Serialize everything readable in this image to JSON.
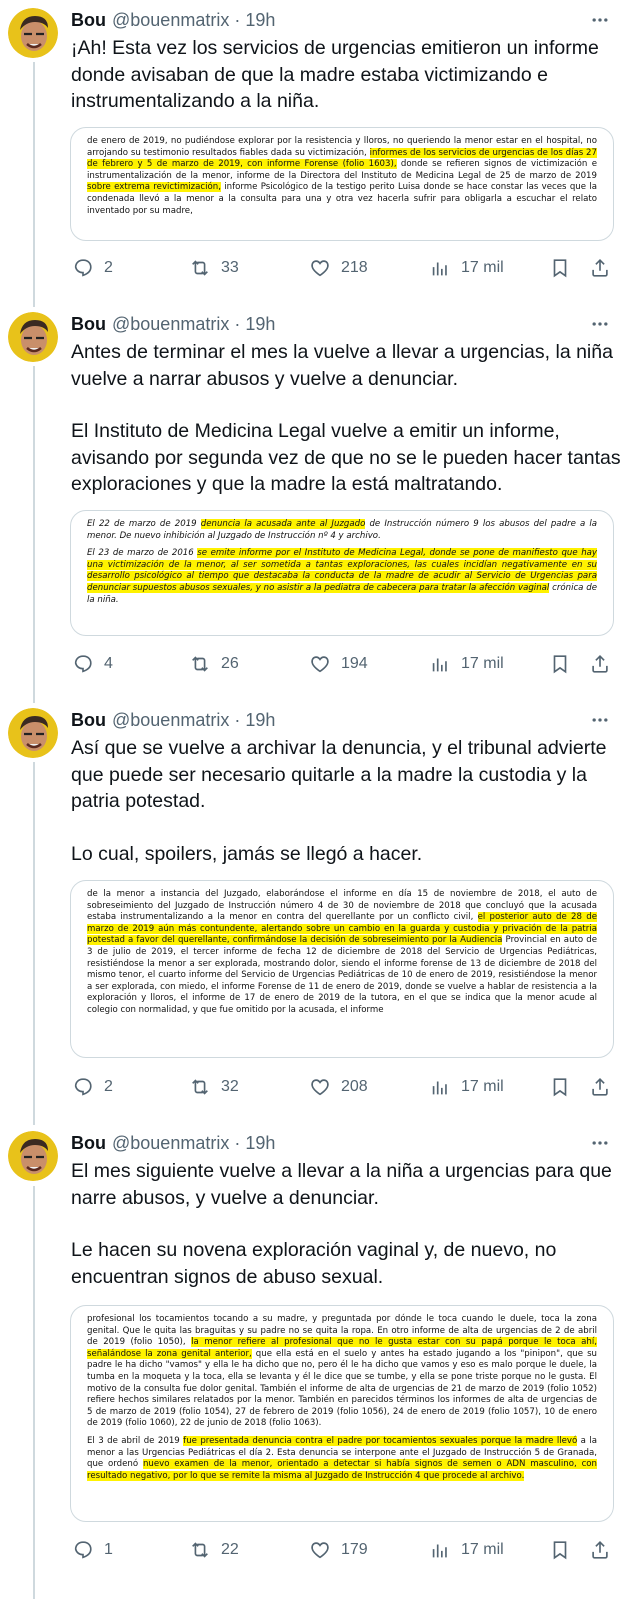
{
  "tweets": [
    {
      "name": "Bou",
      "handle": "@bouenmatrix",
      "dot": "·",
      "time": "19h",
      "paragraphs": [
        "¡Ah! Esta vez los servicios de urgencias emitieron un informe donde avisaban de que la madre estaba victimizando e instrumentalizando a la niña."
      ],
      "doc": {
        "italic": false,
        "paragraphs": [
          [
            {
              "t": "de enero de 2019, no pudiéndose explorar por la resistencia y lloros, no queriendo la menor estar en el hospital, no arrojando su testimonio resultados fiables dada su victimización, ",
              "h": false
            },
            {
              "t": "informes de los servicios de urgencias de los días 27 de febrero y 5 de marzo de 2019, con informe Forense (folio 1603),",
              "h": true
            },
            {
              "t": " donde se refieren signos de victimización e instrumentalización de la menor, informe de la Directora del Instituto de Medicina Legal de 25 de marzo de 2019 ",
              "h": false
            },
            {
              "t": "sobre extrema revictimización,",
              "h": true
            },
            {
              "t": " informe Psicológico de la testigo perito  Luisa  donde se hace constar las veces que la condenada llevó a la menor a la consulta para una y otra vez hacerla sufrir para obligarla a escuchar el relato inventado por su madre,",
              "h": false
            }
          ]
        ]
      },
      "stats": {
        "replies": "2",
        "retweets": "33",
        "likes": "218",
        "views": "17 mil"
      }
    },
    {
      "name": "Bou",
      "handle": "@bouenmatrix",
      "dot": "·",
      "time": "19h",
      "paragraphs": [
        "Antes de terminar el mes la vuelve a llevar a urgencias, la niña vuelve a narrar abusos y vuelve a denunciar.",
        "El Instituto de Medicina Legal vuelve a emitir un informe, avisando por segunda vez de que no se le pueden hacer tantas exploraciones y que la madre la está maltratando."
      ],
      "doc": {
        "italic": true,
        "paragraphs": [
          [
            {
              "t": "El 22 de marzo de 2019 ",
              "h": false
            },
            {
              "t": "denuncia la acusada ante al Juzgado",
              "h": true
            },
            {
              "t": " de Instrucción número 9 los abusos del padre a la menor. De nuevo inhibición al Juzgado de Instrucción nº 4 y archivo.",
              "h": false
            }
          ],
          [
            {
              "t": "El 23 de marzo de 2016 ",
              "h": false
            },
            {
              "t": "se emite informe por el Instituto de Medicina Legal, donde se pone de manifiesto que hay una victimización de la menor, al ser sometida a tantas exploraciones, las cuales incidían negativamente en su desarrollo psicológico al tiempo que destacaba la conducta de la madre de acudir al Servicio de Urgencias para denunciar supuestos abusos sexuales, y no asistir a la pediatra de cabecera para tratar la afección vaginal",
              "h": true
            },
            {
              "t": " crónica de la niña.",
              "h": false
            }
          ]
        ]
      },
      "stats": {
        "replies": "4",
        "retweets": "26",
        "likes": "194",
        "views": "17 mil"
      }
    },
    {
      "name": "Bou",
      "handle": "@bouenmatrix",
      "dot": "·",
      "time": "19h",
      "paragraphs": [
        "Así que se vuelve a archivar la denuncia, y el tribunal advierte que puede ser necesario quitarle a la madre la custodia y la patria potestad.",
        "Lo cual, spoilers, jamás se llegó a hacer."
      ],
      "doc": {
        "italic": false,
        "paragraphs": [
          [
            {
              "t": "de la menor a instancia del Juzgado, elaborándose el informe en día 15 de noviembre de 2018, el auto de sobreseimiento del Juzgado de Instrucción número 4 de 30 de noviembre de 2018 que concluyó que la acusada estaba instrumentalizando a la menor en contra del querellante por un conflicto civil, ",
              "h": false
            },
            {
              "t": "el posterior auto de 28 de marzo de 2019 aún más contundente, alertando sobre un cambio en la guarda y custodia y privación de la patria potestad a favor del querellante, confirmándose la decisión de sobreseimiento por la Audiencia",
              "h": true
            },
            {
              "t": " Provincial en auto de 3 de julio de 2019, el tercer informe de fecha 12 de diciembre de 2018 del Servicio de Urgencias Pediátricas, resistiéndose la menor a ser explorada, mostrando dolor, siendo el informe forense de 13 de diciembre de 2018 del mismo tenor, el cuarto informe del Servicio de Urgencias Pediátricas de 10 de enero de 2019, resistiéndose la menor a ser explorada, con miedo, el informe Forense de 11 de enero de 2019, donde se vuelve a hablar de resistencia a la exploración y lloros, el informe de 17 de enero de 2019 de la tutora, en el que se indica que la menor acude al colegio con normalidad, y que fue omitido por la acusada, el informe",
              "h": false
            }
          ]
        ]
      },
      "stats": {
        "replies": "2",
        "retweets": "32",
        "likes": "208",
        "views": "17 mil"
      }
    },
    {
      "name": "Bou",
      "handle": "@bouenmatrix",
      "dot": "·",
      "time": "19h",
      "paragraphs": [
        "El mes siguiente vuelve a llevar a la niña a urgencias para que narre abusos, y vuelve a denunciar.",
        "Le hacen su novena exploración vaginal y, de nuevo, no encuentran signos de abuso sexual."
      ],
      "doc": {
        "italic": false,
        "paragraphs": [
          [
            {
              "t": "profesional los tocamientos tocando a su madre, y preguntada por dónde le toca cuando le duele, toca la zona genital. Que le quita las braguitas y su padre no se quita la ropa. En otro informe de alta de urgencias de 2 de abril de 2019 (folio 1050), ",
              "h": false
            },
            {
              "t": "la menor refiere al profesional que no le gusta estar con su papá porque le toca ahí, señalándose la zona genital anterior,",
              "h": true
            },
            {
              "t": " que ella está en el suelo y antes ha estado jugando a los \"pinipon\", que su padre le ha dicho \"vamos\" y ella le ha dicho que no, pero él le ha dicho que vamos y eso es malo porque le duele, la tumba en la moqueta y la toca, ella se levanta y él le dice que se tumbe, y ella se pone triste porque no le gusta. El motivo de la consulta fue dolor genital. También el informe de alta de urgencias de 21 de marzo de 2019 (folio 1052) refiere hechos similares relatados por la menor. También en parecidos términos los informes de alta de urgencias de 5 de marzo de 2019 (folio 1054), 27 de febrero de 2019 (folio 1056), 24 de enero de 2019 (folio 1057), 10 de enero de 2019 (folio 1060), 22 de junio de 2018 (folio 1063).",
              "h": false
            }
          ],
          [
            {
              "t": "El 3 de abril de 2019 ",
              "h": false
            },
            {
              "t": "fue presentada denuncia contra el padre por tocamientos sexuales porque la madre llevó",
              "h": true
            },
            {
              "t": " a la menor a las Urgencias Pediátricas el día 2. Esta denuncia se interpone ante el Juzgado de Instrucción 5 de Granada, que ordenó ",
              "h": false
            },
            {
              "t": "nuevo examen de la menor, orientado a detectar si había signos de semen o ADN masculino, con resultado negativo, por lo que se remite la misma al Juzgado de Instrucción 4 que procede al archivo.",
              "h": true
            }
          ]
        ]
      },
      "stats": {
        "replies": "1",
        "retweets": "22",
        "likes": "179",
        "views": "17 mil"
      }
    }
  ]
}
